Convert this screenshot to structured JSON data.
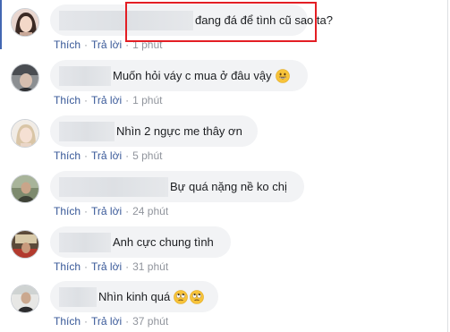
{
  "actions": {
    "like": "Thích",
    "reply": "Trả lời",
    "separator": "·"
  },
  "comments": [
    {
      "text": "đang đá để tình cũ sao ta?",
      "time": "1 phút",
      "emoji": []
    },
    {
      "text": "Muốn hỏi váy c mua ở đâu vậy",
      "time": "1 phút",
      "emoji": [
        "grinning-face-emoji"
      ]
    },
    {
      "text": "Nhìn 2 ngực me thây ơn",
      "time": "5 phút",
      "emoji": []
    },
    {
      "text": "Bự quá nặng nề ko chị",
      "time": "24 phút",
      "emoji": []
    },
    {
      "text": "Anh cực chung tình",
      "time": "31 phút",
      "emoji": []
    },
    {
      "text": "Nhìn kinh quá",
      "time": "37 phút",
      "emoji": [
        "eye-roll-emoji",
        "eye-roll-emoji"
      ]
    }
  ],
  "colors": {
    "bubble": "#f2f3f5",
    "link": "#385898",
    "muted": "#90949c",
    "highlight": "#e31e24",
    "accent_bar": "#4267b2"
  }
}
